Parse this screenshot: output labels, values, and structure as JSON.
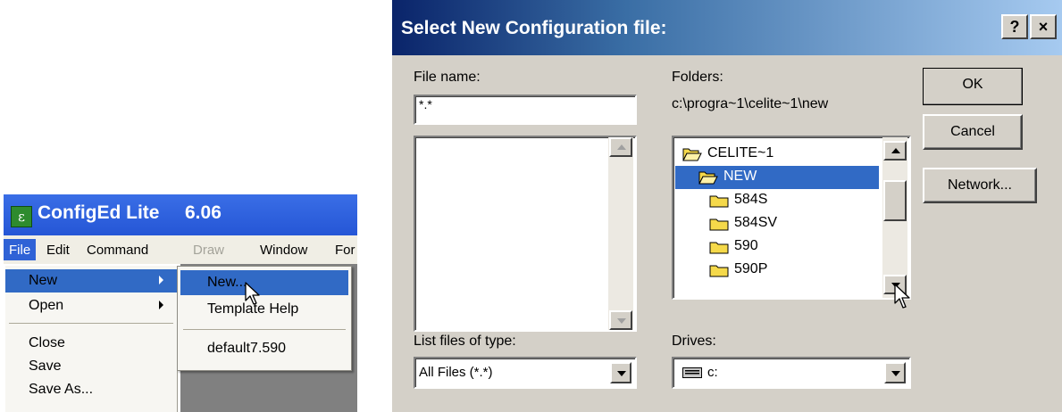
{
  "app": {
    "title": "ConfigEd Lite",
    "version": "6.06",
    "logo_glyph": "ε",
    "menubar": [
      "File",
      "Edit",
      "Command",
      "Draw",
      "Window",
      "For"
    ],
    "file_menu": {
      "items": [
        "New",
        "Open",
        "Close",
        "Save",
        "Save As..."
      ]
    },
    "new_submenu": {
      "items": [
        "New...",
        "Template Help",
        "default7.590"
      ]
    }
  },
  "dialog": {
    "title": "Select New Configuration file:",
    "help_button": "?",
    "close_button": "×",
    "file_name_label": "File name:",
    "file_name_value": "*.*",
    "folders_label": "Folders:",
    "folders_path": "c:\\progra~1\\celite~1\\new",
    "folders": [
      "CELITE~1",
      "NEW",
      "584S",
      "584SV",
      "590",
      "590P"
    ],
    "list_type_label": "List files of type:",
    "list_type_value": "All Files (*.*)",
    "drives_label": "Drives:",
    "drive_value": "c:",
    "ok_button": "OK",
    "cancel_button": "Cancel",
    "network_button": "Network..."
  },
  "colors": {
    "menu_highlight": "#316ac5",
    "xp_title_blue": "#2556d6",
    "dialog_face": "#d4d0c8",
    "folder_yellow": "#f5d94a"
  }
}
